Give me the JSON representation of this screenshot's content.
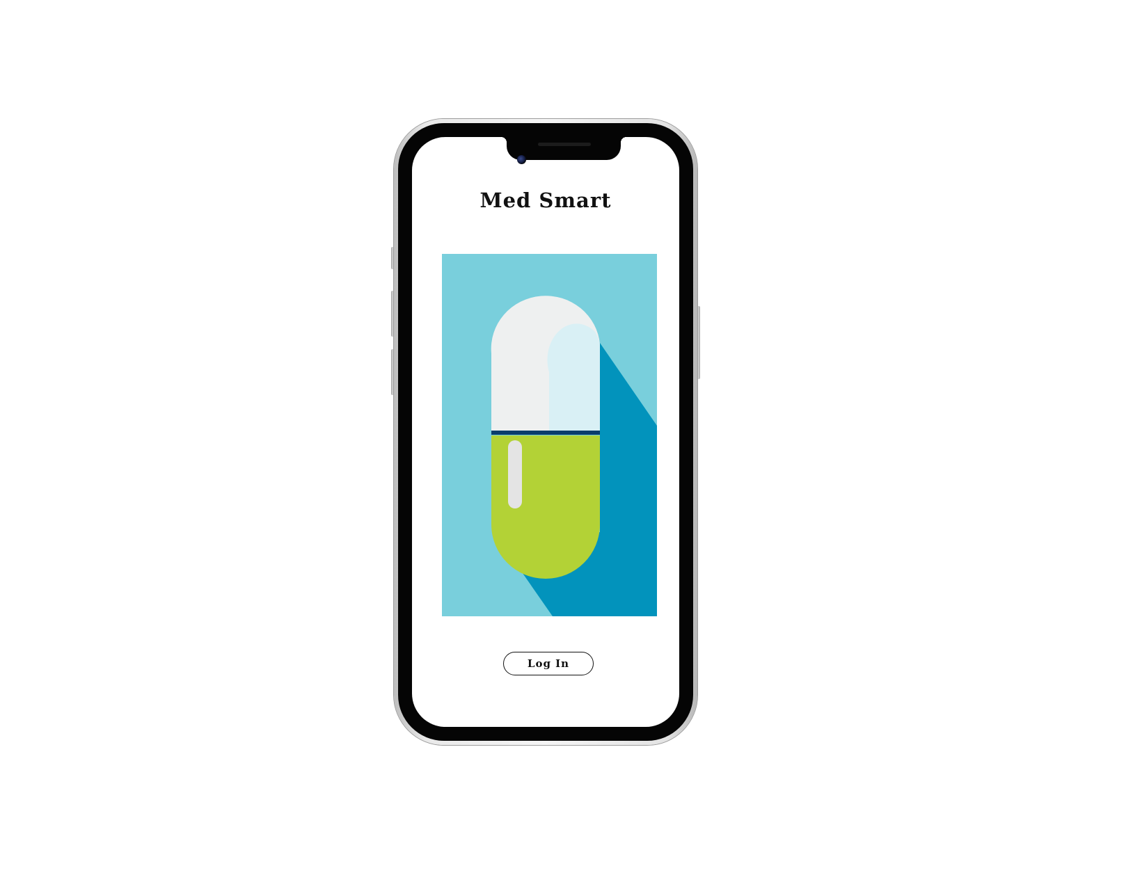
{
  "app": {
    "title": "Med Smart"
  },
  "hero": {
    "icon": "capsule-pill-icon",
    "colors": {
      "background": "#79cfdc",
      "shadow": "#0293bc",
      "capsule_top": "#eef0f0",
      "capsule_top_highlight": "#d9f0f5",
      "capsule_bottom": "#b3d236",
      "capsule_band": "#0b3d6b",
      "capsule_highlight": "#e4e4e4"
    }
  },
  "actions": {
    "login_label": "Log In"
  }
}
